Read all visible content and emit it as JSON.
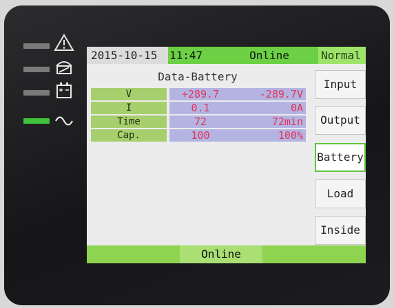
{
  "indicators": [
    {
      "icon": "warning-icon",
      "led_color": "#7a7a7a"
    },
    {
      "icon": "bypass-icon",
      "led_color": "#7a7a7a"
    },
    {
      "icon": "battery-icon",
      "led_color": "#7a7a7a"
    },
    {
      "icon": "ac-line-icon",
      "led_color": "#3fc23a"
    }
  ],
  "header": {
    "date": "2015-10-15",
    "time": "11:47",
    "status": "Online",
    "mode": "Normal"
  },
  "panel": {
    "title": "Data-Battery",
    "rows": [
      {
        "label": "V",
        "value1": "+289.7",
        "value2": "-289.7V"
      },
      {
        "label": "I",
        "value1": "0.1",
        "value2": "0A"
      },
      {
        "label": "Time",
        "value1": "72",
        "value2": "72min"
      },
      {
        "label": "Cap.",
        "value1": "100",
        "value2": "100%"
      }
    ]
  },
  "sidebar": {
    "items": [
      {
        "label": "Input"
      },
      {
        "label": "Output"
      },
      {
        "label": "Battery",
        "active": true
      },
      {
        "label": "Load"
      },
      {
        "label": "Inside"
      }
    ]
  },
  "footer": {
    "status": "Online"
  },
  "colors": {
    "accent_green": "#6bd044",
    "value_red": "#e2345a",
    "label_green": "#a7cf6e",
    "value_bg": "#b4b4e2"
  }
}
